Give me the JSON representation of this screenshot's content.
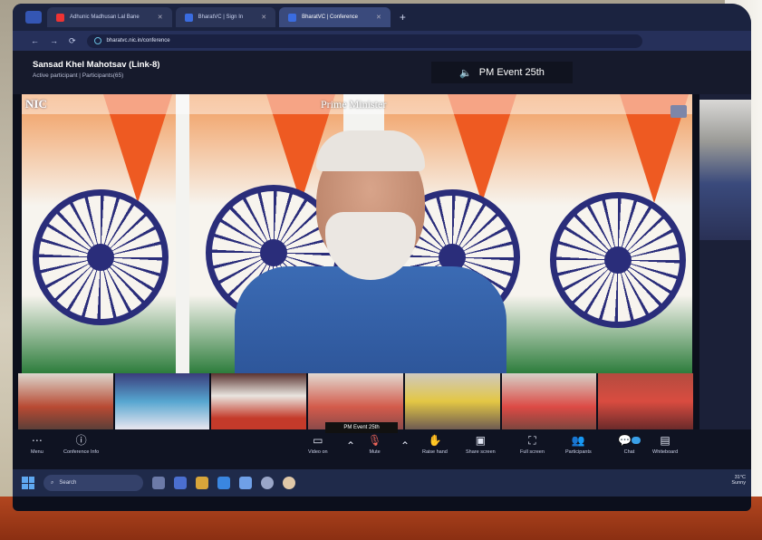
{
  "browser": {
    "tabs": [
      {
        "label": "Adhunic Madhusan Lal Bane",
        "active": false
      },
      {
        "label": "BharatVC | Sign In",
        "active": false
      },
      {
        "label": "BharatVC | Conference",
        "active": true
      }
    ],
    "new_tab": "+",
    "url": "bharatvc.nic.in/conference",
    "nav_back": "←",
    "nav_forward": "→",
    "nav_reload": "⟳"
  },
  "meeting": {
    "title": "Sansad Khel Mahotsav (Link-8)",
    "subtitle": "Active participant  |  Participants(65)",
    "active_speaker": "PM Event 25th"
  },
  "main_video": {
    "logo_text": "NIC",
    "caption": "Prime Minister"
  },
  "thumbnail_strip": {
    "active_label": "PM Event 25th",
    "count": 7
  },
  "controls": {
    "more_label": "Menu",
    "info_label": "Conference Info",
    "video_label": "Video on",
    "audio_label": "Mute",
    "raise_hand_label": "Raise hand",
    "share_label": "Share screen",
    "fullscreen_label": "Full screen",
    "participants_label": "Participants",
    "chat_label": "Chat",
    "whiteboard_label": "Whiteboard"
  },
  "taskbar": {
    "search_placeholder": "Search",
    "weather": "31°C",
    "weather_desc": "Sunny"
  },
  "colors": {
    "saffron": "#ee5a22",
    "chakra_blue": "#2a2d7a",
    "jacket_blue": "#3b6bb4",
    "ui_dark": "#0f1322"
  },
  "icons": {
    "more": "more-icon",
    "info": "info-icon",
    "video": "video-camera-icon",
    "mic": "microphone-icon",
    "hand": "raise-hand-icon",
    "share": "share-screen-icon",
    "fullscreen": "fullscreen-icon",
    "participants": "participants-icon",
    "chat": "chat-icon",
    "whiteboard": "whiteboard-icon"
  }
}
